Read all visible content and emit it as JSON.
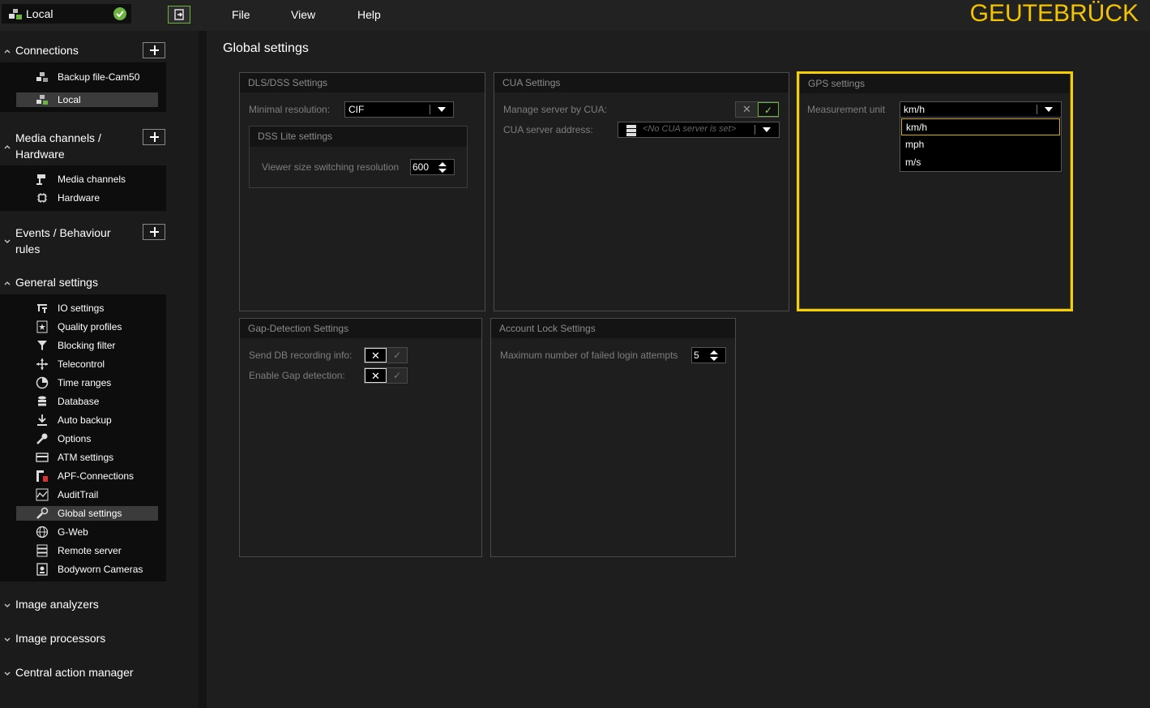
{
  "topbar": {
    "connection_label": "Local",
    "menu": [
      "File",
      "View",
      "Help"
    ],
    "logo": "GEUTEBRÜCK",
    "accent_color": "#6cb33f",
    "logo_color": "#f5c400"
  },
  "sidebar": {
    "connections": {
      "title": "Connections",
      "items": [
        "Backup file-Cam50",
        "Local"
      ],
      "selected": "Local"
    },
    "media": {
      "title_line1": "Media channels /",
      "title_line2": "Hardware",
      "items": [
        "Media channels",
        "Hardware"
      ]
    },
    "events": {
      "title_line1": "Events / Behaviour",
      "title_line2": "rules"
    },
    "general": {
      "title": "General settings",
      "items": [
        "IO settings",
        "Quality profiles",
        "Blocking filter",
        "Telecontrol",
        "Time ranges",
        "Database",
        "Auto backup",
        "Options",
        "ATM settings",
        "APF-Connections",
        "AuditTrail",
        "Global settings",
        "G-Web",
        "Remote server",
        "Bodyworn Cameras"
      ],
      "selected": "Global settings"
    },
    "collapsed": [
      "Image analyzers",
      "Image processors",
      "Central action manager"
    ]
  },
  "main": {
    "title": "Global settings",
    "dls": {
      "title": "DLS/DSS Settings",
      "min_res_label": "Minimal resolution:",
      "min_res_value": "CIF",
      "lite_title": "DSS Lite settings",
      "viewer_label": "Viewer size switching resolution",
      "viewer_value": "600"
    },
    "cua": {
      "title": "CUA Settings",
      "manage_label": "Manage server by CUA:",
      "manage_state": "on",
      "address_label": "CUA server address:",
      "address_placeholder": "<No CUA server is set>"
    },
    "gps": {
      "title": "GPS settings",
      "unit_label": "Measurement unit",
      "unit_value": "km/h",
      "options": [
        "km/h",
        "mph",
        "m/s"
      ],
      "highlighted_option": "km/h"
    },
    "gap": {
      "title": "Gap-Detection Settings",
      "send_label": "Send DB recording info:",
      "send_state": "off",
      "enable_label": "Enable Gap detection:",
      "enable_state": "off"
    },
    "lock": {
      "title": "Account Lock Settings",
      "max_label": "Maximum number of failed login attempts",
      "max_value": "5"
    }
  },
  "icons": {
    "check": "✓",
    "cross": "✕"
  }
}
